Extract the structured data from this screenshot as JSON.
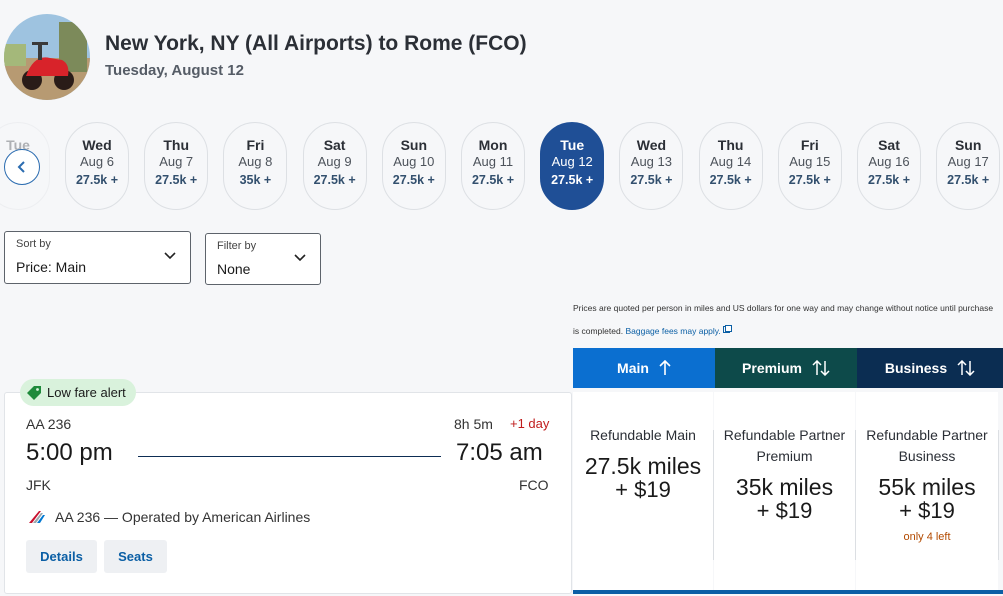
{
  "header": {
    "route_title": "New York, NY (All Airports) to Rome (FCO)",
    "date": "Tuesday, August 12"
  },
  "date_strip": {
    "partial_left": {
      "dow": "Tue",
      "md": "",
      "price": "+"
    },
    "days": [
      {
        "dow": "Wed",
        "md": "Aug 6",
        "price": "27.5k +",
        "selected": false
      },
      {
        "dow": "Thu",
        "md": "Aug 7",
        "price": "27.5k +",
        "selected": false
      },
      {
        "dow": "Fri",
        "md": "Aug 8",
        "price": "35k +",
        "selected": false
      },
      {
        "dow": "Sat",
        "md": "Aug 9",
        "price": "27.5k +",
        "selected": false
      },
      {
        "dow": "Sun",
        "md": "Aug 10",
        "price": "27.5k +",
        "selected": false
      },
      {
        "dow": "Mon",
        "md": "Aug 11",
        "price": "27.5k +",
        "selected": false
      },
      {
        "dow": "Tue",
        "md": "Aug 12",
        "price": "27.5k +",
        "selected": true
      },
      {
        "dow": "Wed",
        "md": "Aug 13",
        "price": "27.5k +",
        "selected": false
      },
      {
        "dow": "Thu",
        "md": "Aug 14",
        "price": "27.5k +",
        "selected": false
      },
      {
        "dow": "Fri",
        "md": "Aug 15",
        "price": "27.5k +",
        "selected": false
      },
      {
        "dow": "Sat",
        "md": "Aug 16",
        "price": "27.5k +",
        "selected": false
      },
      {
        "dow": "Sun",
        "md": "Aug 17",
        "price": "27.5k +",
        "selected": false
      }
    ]
  },
  "sort": {
    "label": "Sort by",
    "value": "Price: Main"
  },
  "filter": {
    "label": "Filter by",
    "value": "None"
  },
  "disclaimer": {
    "text": "Prices are quoted per person in miles and US dollars for one way and may change without notice until purchase is completed.",
    "baggage_link": "Baggage fees may apply."
  },
  "cabin_tabs": [
    {
      "label": "Main",
      "color": "#0b6fd0"
    },
    {
      "label": "Premium",
      "color": "#0d4a4a"
    },
    {
      "label": "Business",
      "color": "#0b2d52"
    }
  ],
  "flight": {
    "badge": "Low fare alert",
    "flight_number": "AA 236",
    "duration": "8h 5m",
    "plus_day": "+1 day",
    "depart_time": "5:00 pm",
    "arrive_time": "7:05 am",
    "from": "JFK",
    "to": "FCO",
    "operated_by": "AA 236 — Operated by American Airlines",
    "details_label": "Details",
    "seats_label": "Seats"
  },
  "fares": [
    {
      "name": "Refundable Main",
      "miles": "27.5k miles",
      "fee": "+ $19",
      "note": ""
    },
    {
      "name": "Refundable Partner Premium",
      "miles": "35k miles",
      "fee": "+ $19",
      "note": ""
    },
    {
      "name": "Refundable Partner Business",
      "miles": "55k miles",
      "fee": "+ $19",
      "note": "only 4 left"
    }
  ],
  "colors": {
    "selected_date": "#1f4f96",
    "link": "#0b5fa5",
    "alert_red": "#c01c1c",
    "low_fare_green": "#d9f2dc"
  }
}
